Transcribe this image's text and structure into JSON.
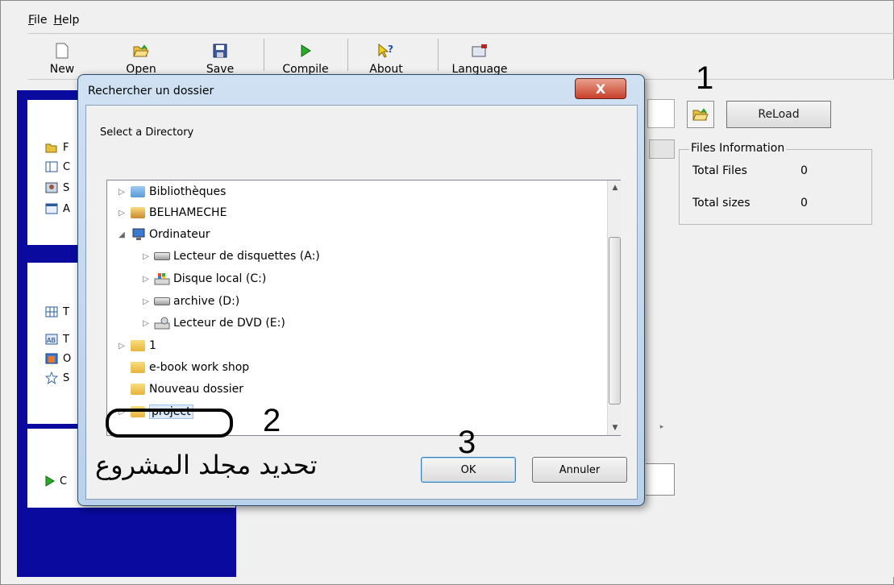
{
  "menu": {
    "file": "File",
    "help": "Help"
  },
  "toolbar": {
    "new": "New",
    "open": "Open",
    "save": "Save",
    "compile": "Compile",
    "about": "About",
    "language": "Language"
  },
  "main": {
    "reload": "ReLoad",
    "files_info": {
      "legend": "Files Information",
      "total_files_label": "Total Files",
      "total_files_value": "0",
      "total_sizes_label": "Total sizes",
      "total_sizes_value": "0"
    }
  },
  "sidebar": {
    "panel1_items": [
      {
        "label": "F",
        "icon": "folder-open-icon"
      },
      {
        "label": "C",
        "icon": "window-icon"
      },
      {
        "label": "S",
        "icon": "portrait-icon"
      },
      {
        "label": "A",
        "icon": "form-icon"
      }
    ],
    "panel2_items": [
      {
        "label": "T",
        "icon": "grid-icon"
      },
      {
        "label": "T",
        "icon": "textbox-icon"
      },
      {
        "label": "O",
        "icon": "image-icon"
      },
      {
        "label": "S",
        "icon": "star-icon"
      }
    ],
    "panel3_items": [
      {
        "label": "C",
        "icon": "play-icon"
      }
    ]
  },
  "dialog": {
    "title": "Rechercher un dossier",
    "close": "X",
    "prompt": "Select a Directory",
    "tree": [
      "Bibliothèques",
      "BELHAMECHE",
      "Ordinateur",
      "Lecteur de disquettes (A:)",
      "Disque local (C:)",
      "archive (D:)",
      "Lecteur de DVD (E:)",
      "1",
      "e-book work shop",
      "Nouveau dossier",
      "project"
    ],
    "ok": "OK",
    "cancel": "Annuler"
  },
  "annotations": {
    "step1": "1",
    "step2": "2",
    "step3": "3",
    "caption": "تحديد مجلد المشروع"
  },
  "colors": {
    "sidebar_bg": "#0a0a9e",
    "close_red": "#c8402a",
    "dialog_frame": "#b9d1ea"
  }
}
